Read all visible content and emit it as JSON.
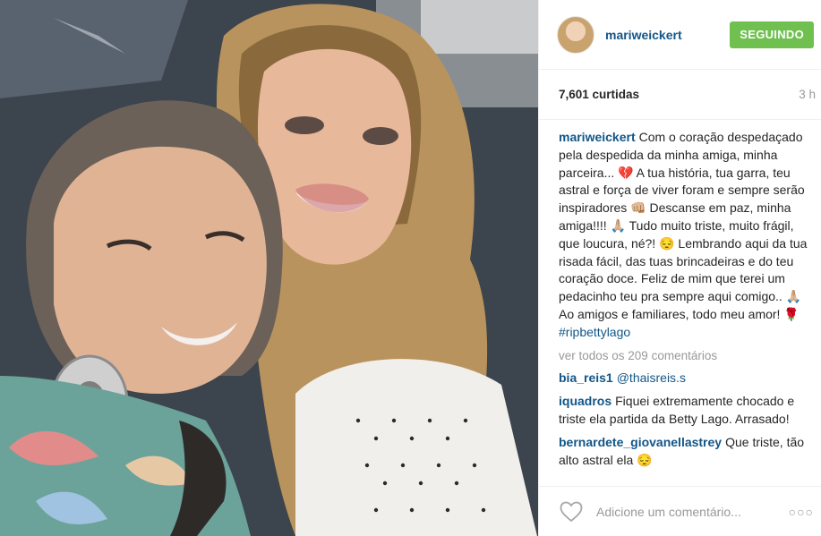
{
  "post": {
    "image_alt": ""
  },
  "header": {
    "username": "mariweickert",
    "follow_label": "SEGUINDO"
  },
  "meta": {
    "likes": "7,601 curtidas",
    "time": "3 h"
  },
  "caption": {
    "user": "mariweickert",
    "text": "Com o coração despedaçado pela despedida da minha amiga, minha parceira... 💔 A tua história, tua garra, teu astral e força de viver foram e sempre serão inspiradores 👊🏼 Descanse em paz, minha amiga!!!! 🙏🏼 Tudo muito triste, muito frágil, que loucura, né?! 😔 Lembrando aqui da tua risada fácil, das tuas brincadeiras e do teu coração doce. Feliz de mim que terei um pedacinho teu pra sempre aqui comigo.. 🙏🏼 Ao amigos e familiares, todo meu amor! 🌹",
    "hashtag": "#ripbettylago"
  },
  "view_all": "ver todos os 209 comentários",
  "comments": [
    {
      "user": "bia_reis1",
      "text": "",
      "mention": "@thaisreis.s"
    },
    {
      "user": "iquadros",
      "text": "Fiquei extremamente chocado e triste ela partida da Betty Lago. Arrasado!",
      "mention": ""
    },
    {
      "user": "bernardete_giovanellastrey",
      "text": "Que triste, tão alto astral ela 😔",
      "mention": ""
    }
  ],
  "footer": {
    "comment_placeholder": "Adicione um comentário...",
    "more_label": "○○○"
  },
  "colors": {
    "link": "#125688",
    "follow_button": "#70c050",
    "muted": "#999999"
  }
}
